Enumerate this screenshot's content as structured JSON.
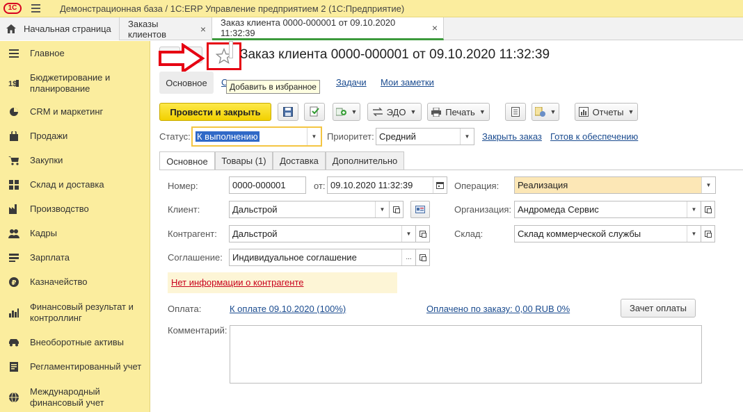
{
  "app": {
    "logo_text": "1С",
    "title": "Демонстрационная база / 1С:ERP Управление предприятием 2  (1С:Предприятие)"
  },
  "tabs": {
    "home": "Начальная страница",
    "items": [
      {
        "label": "Заказы клиентов",
        "close": "×"
      },
      {
        "label": "Заказ клиента 0000-000001 от 09.10.2020 11:32:39",
        "close": "×"
      }
    ]
  },
  "sidebar": {
    "items": [
      {
        "label": "Главное",
        "icon": "menu-lines-icon"
      },
      {
        "label": "Бюджетирование и планирование",
        "icon": "budget-icon"
      },
      {
        "label": "CRM и маркетинг",
        "icon": "pie-chart-icon"
      },
      {
        "label": "Продажи",
        "icon": "shopping-bag-icon"
      },
      {
        "label": "Закупки",
        "icon": "cart-icon"
      },
      {
        "label": "Склад и доставка",
        "icon": "warehouse-grid-icon"
      },
      {
        "label": "Производство",
        "icon": "factory-icon"
      },
      {
        "label": "Кадры",
        "icon": "people-icon"
      },
      {
        "label": "Зарплата",
        "icon": "payroll-icon"
      },
      {
        "label": "Казначейство",
        "icon": "ruble-coin-icon"
      },
      {
        "label": "Финансовый результат и контроллинг",
        "icon": "bar-chart-icon"
      },
      {
        "label": "Внеоборотные активы",
        "icon": "car-icon"
      },
      {
        "label": "Регламентированный учет",
        "icon": "report-icon"
      },
      {
        "label": "Международный финансовый учет",
        "icon": "globe-icon"
      }
    ]
  },
  "document": {
    "title": "Заказ клиента 0000-000001 от 09.10.2020 11:32:39",
    "tooltip": "Добавить в избранное",
    "subtabs": {
      "main": "Основное",
      "hidden_partial": "С",
      "tasks": "Задачи",
      "notes": "Мои заметки"
    }
  },
  "toolbar": {
    "post_close": "Провести и закрыть",
    "edo": "ЭДО",
    "print": "Печать",
    "reports": "Отчеты"
  },
  "status_row": {
    "status_label": "Статус:",
    "status_value": "К выполнению",
    "priority_label": "Приоритет:",
    "priority_value": "Средний",
    "close_order": "Закрыть заказ",
    "ready_supply": "Готов к обеспечению"
  },
  "form_tabs": [
    "Основное",
    "Товары (1)",
    "Доставка",
    "Дополнительно"
  ],
  "form": {
    "number_label": "Номер:",
    "number_value": "0000-000001",
    "from_label": "от:",
    "date_value": "09.10.2020 11:32:39",
    "operation_label": "Операция:",
    "operation_value": "Реализация",
    "client_label": "Клиент:",
    "client_value": "Дальстрой",
    "org_label": "Организация:",
    "org_value": "Андромеда Сервис",
    "contractor_label": "Контрагент:",
    "contractor_value": "Дальстрой",
    "warehouse_label": "Склад:",
    "warehouse_value": "Склад коммерческой службы",
    "agreement_label": "Соглашение:",
    "agreement_value": "Индивидуальное соглашение",
    "no_info": "Нет информации о контрагенте",
    "payment_label": "Оплата:",
    "payment_link": "К оплате 09.10.2020 (100%)",
    "paid_link": "Оплачено по заказу: 0,00 RUB 0%",
    "offset_button": "Зачет оплаты",
    "comment_label": "Комментарий:",
    "comment_value": "",
    "dots": "..."
  },
  "colors": {
    "sidebar_bg": "#fbed9e",
    "primary_button": "#f2d100",
    "highlight_red": "#e60012",
    "link": "#1a4b8f",
    "active_tab_underline": "#3c9a3c"
  }
}
